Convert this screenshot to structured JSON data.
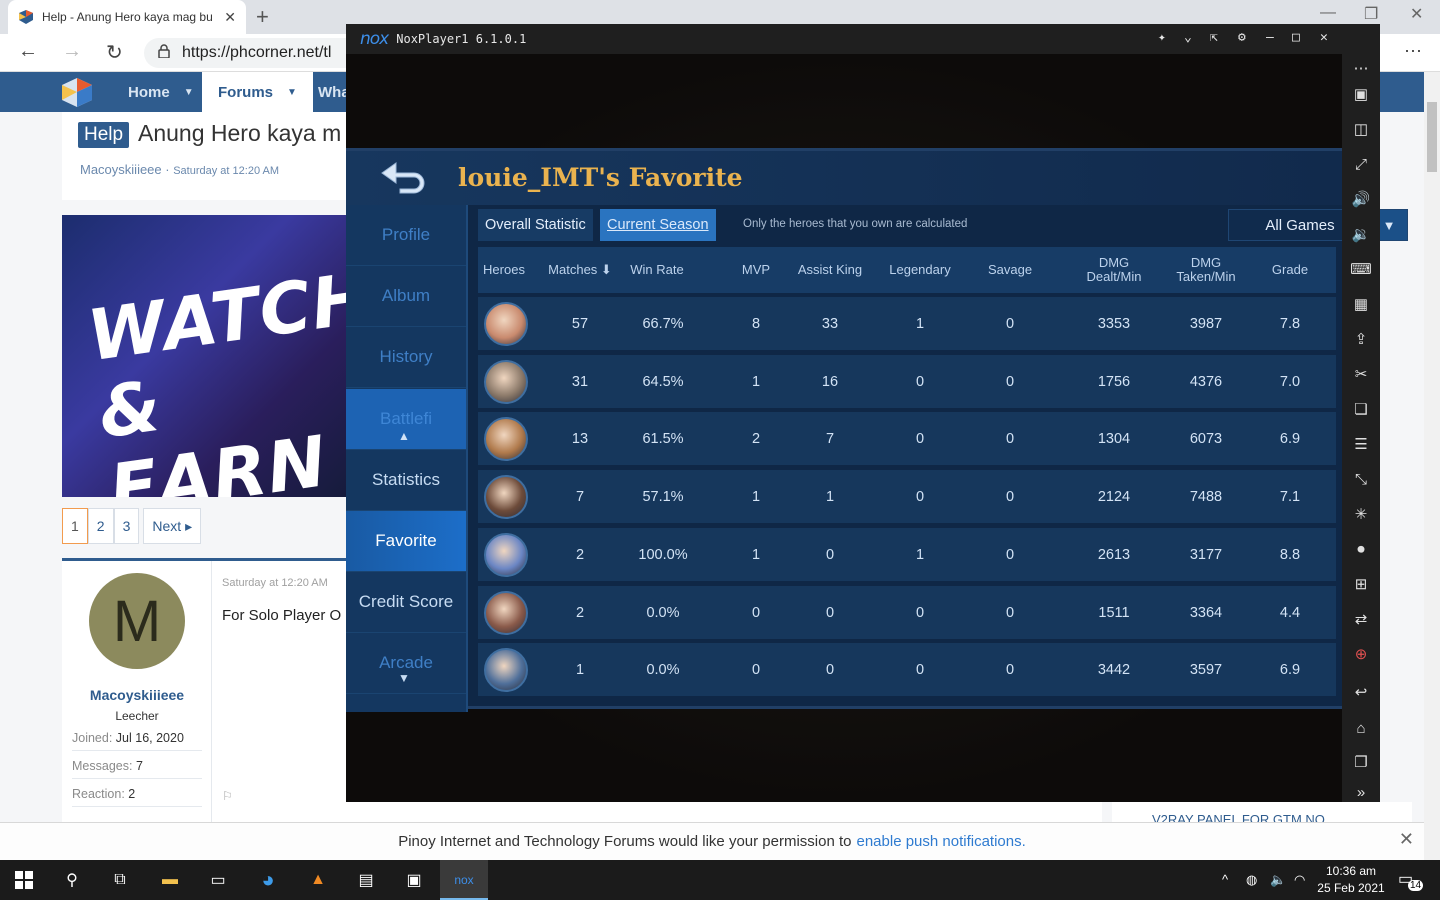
{
  "browser": {
    "tab_title": "Help - Anung Hero kaya mag bu",
    "url": "https://phcorner.net/tl"
  },
  "forum": {
    "nav": [
      {
        "label": "Home"
      },
      {
        "label": "Forums"
      },
      {
        "label": "Wha"
      }
    ],
    "thread": {
      "prefix": "Help",
      "title": "Anung Hero kaya m",
      "author": "Macoyskiiieee ·",
      "date": "Saturday at 12:20 AM"
    },
    "banner": {
      "line1": "WATCH &",
      "line2": "EARN"
    },
    "pager": [
      "1",
      "2",
      "3",
      "Next ▸"
    ],
    "post": {
      "date": "Saturday at 12:20 AM",
      "body": "For Solo Player O",
      "avatar_letter": "M",
      "username": "Macoyskiiieee",
      "role": "Leecher",
      "stats": [
        {
          "label": "Joined:",
          "value": "Jul 16, 2020"
        },
        {
          "label": "Messages:",
          "value": "7"
        },
        {
          "label": "Reaction:",
          "value": "2"
        }
      ]
    },
    "side_peek": "V2RAY PANEL FOR GTM NO",
    "notification": {
      "text": "Pinoy Internet and Technology Forums would like your permission to",
      "link": "enable push notifications."
    }
  },
  "nox": {
    "logo": "nox",
    "title": "NoxPlayer1 6.1.0.1",
    "game": {
      "title": "louie_IMT's Favorite",
      "nav": [
        "Profile",
        "Album",
        "History",
        "Battlefi",
        "Statistics",
        "Favorite",
        "Credit Score",
        "Arcade"
      ],
      "tabs": [
        "Overall Statistic",
        "Current Season"
      ],
      "hint": "Only the heroes that you own are calculated",
      "filter": "All Games",
      "headers": [
        "Heroes",
        "Matches ⬇",
        "Win Rate",
        "MVP",
        "Assist King",
        "Legendary",
        "Savage",
        "DMG Dealt/Min",
        "DMG Taken/Min",
        "Grade"
      ],
      "rows": [
        {
          "matches": "57",
          "win_rate": "66.7%",
          "mvp": "8",
          "assist": "33",
          "legendary": "1",
          "savage": "0",
          "dealt": "3353",
          "taken": "3987",
          "grade": "7.8",
          "color": "#c98a6e"
        },
        {
          "matches": "31",
          "win_rate": "64.5%",
          "mvp": "1",
          "assist": "16",
          "legendary": "0",
          "savage": "0",
          "dealt": "1756",
          "taken": "4376",
          "grade": "7.0",
          "color": "#8c7a6a"
        },
        {
          "matches": "13",
          "win_rate": "61.5%",
          "mvp": "2",
          "assist": "7",
          "legendary": "0",
          "savage": "0",
          "dealt": "1304",
          "taken": "6073",
          "grade": "6.9",
          "color": "#b07a4c"
        },
        {
          "matches": "7",
          "win_rate": "57.1%",
          "mvp": "1",
          "assist": "1",
          "legendary": "0",
          "savage": "0",
          "dealt": "2124",
          "taken": "7488",
          "grade": "7.1",
          "color": "#6d4b3a"
        },
        {
          "matches": "2",
          "win_rate": "100.0%",
          "mvp": "1",
          "assist": "0",
          "legendary": "1",
          "savage": "0",
          "dealt": "2613",
          "taken": "3177",
          "grade": "8.8",
          "color": "#6b86c4"
        },
        {
          "matches": "2",
          "win_rate": "0.0%",
          "mvp": "0",
          "assist": "0",
          "legendary": "0",
          "savage": "0",
          "dealt": "1511",
          "taken": "3364",
          "grade": "4.4",
          "color": "#8a5a4a"
        },
        {
          "matches": "1",
          "win_rate": "0.0%",
          "mvp": "0",
          "assist": "0",
          "legendary": "0",
          "savage": "0",
          "dealt": "3442",
          "taken": "3597",
          "grade": "6.9",
          "color": "#4f6f9a"
        }
      ]
    }
  },
  "taskbar": {
    "time": "10:36 am",
    "date": "25 Feb 2021",
    "notif_count": "14"
  }
}
